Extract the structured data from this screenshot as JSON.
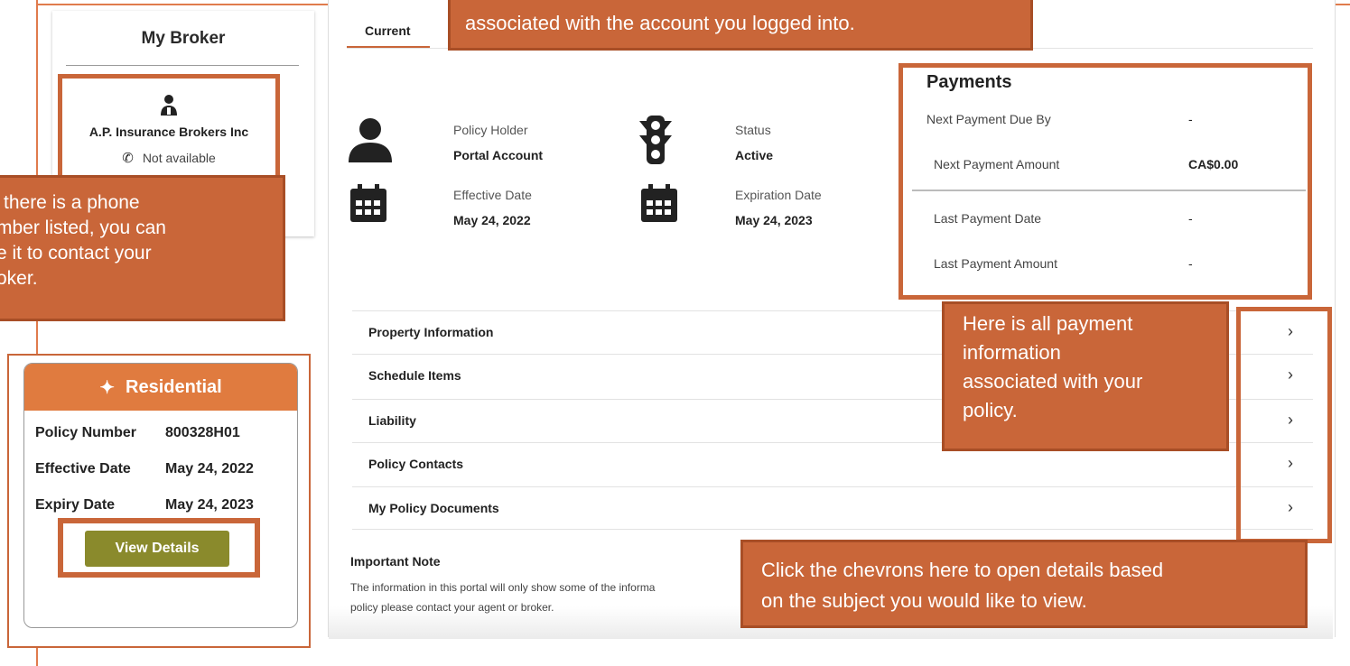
{
  "broker": {
    "title": "My Broker",
    "name": "A.P. Insurance Brokers Inc",
    "phone": "Not available"
  },
  "callouts": {
    "top": "associated with the account you logged into.",
    "phone_lines": [
      "there is a phone",
      "mber listed, you can",
      "e it to contact your",
      "oker."
    ],
    "payment_lines": [
      "Here is all payment",
      "information",
      "associated with your",
      "policy."
    ],
    "chevron_lines": [
      "Click the chevrons here to open details based",
      "on the subject you would like to view."
    ]
  },
  "residential": {
    "title": "Residential",
    "rows": [
      {
        "label": "Policy Number",
        "value": "800328H01"
      },
      {
        "label": "Effective Date",
        "value": "May 24, 2022"
      },
      {
        "label": "Expiry Date",
        "value": "May 24, 2023"
      }
    ],
    "button": "View Details"
  },
  "main": {
    "tab": "Current",
    "policy_holder_label": "Policy Holder",
    "policy_holder_value": "Portal Account",
    "status_label": "Status",
    "status_value": "Active",
    "effective_label": "Effective Date",
    "effective_value": "May 24, 2022",
    "expiration_label": "Expiration Date",
    "expiration_value": "May 24, 2023"
  },
  "payments": {
    "title": "Payments",
    "rows": [
      {
        "label": "Next Payment Due By",
        "value": "-"
      },
      {
        "label": "Next Payment Amount",
        "value": "CA$0.00"
      },
      {
        "label": "Last Payment Date",
        "value": "-"
      },
      {
        "label": "Last Payment Amount",
        "value": "-"
      }
    ]
  },
  "sections": [
    "Property Information",
    "Schedule Items",
    "Liability",
    "Policy Contacts",
    "My Policy Documents"
  ],
  "important": {
    "title": "Important Note",
    "line1": "The information in this portal will only show some of the informa",
    "line2": "policy please contact your agent or broker."
  },
  "colors": {
    "accent": "#c96639",
    "header": "#e07b3f",
    "button": "#8a8a2c"
  }
}
